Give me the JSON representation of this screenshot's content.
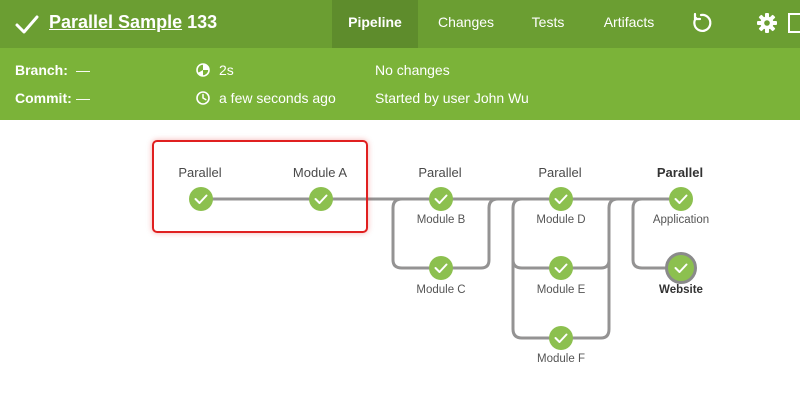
{
  "header": {
    "pipeline_name": "Parallel Sample",
    "run_number": "133",
    "tabs": [
      {
        "label": "Pipeline",
        "active": true
      },
      {
        "label": "Changes",
        "active": false
      },
      {
        "label": "Tests",
        "active": false
      },
      {
        "label": "Artifacts",
        "active": false
      }
    ],
    "icons": [
      "success-check-icon",
      "rerun-icon",
      "gear-icon",
      "exit-icon"
    ]
  },
  "meta": {
    "branch_label": "Branch:",
    "branch_value": "—",
    "commit_label": "Commit:",
    "commit_value": "—",
    "duration": "2s",
    "started_ago": "a few seconds ago",
    "changes": "No changes",
    "started_by": "Started by user John Wu"
  },
  "graph": {
    "stages": [
      {
        "label": "Parallel"
      },
      {
        "label": "Module A"
      },
      {
        "label": "Parallel"
      },
      {
        "label": "Parallel"
      },
      {
        "label": "Parallel"
      }
    ],
    "nodes": [
      {
        "label": "Module B"
      },
      {
        "label": "Module C"
      },
      {
        "label": "Module D"
      },
      {
        "label": "Module E"
      },
      {
        "label": "Module F"
      },
      {
        "label": "Application"
      },
      {
        "label": "Website"
      }
    ]
  },
  "colors": {
    "header_bg": "#6b9e32",
    "meta_bg": "#7bb339",
    "success": "#8cc04f",
    "connector": "#949393",
    "highlight": "#e02020"
  }
}
